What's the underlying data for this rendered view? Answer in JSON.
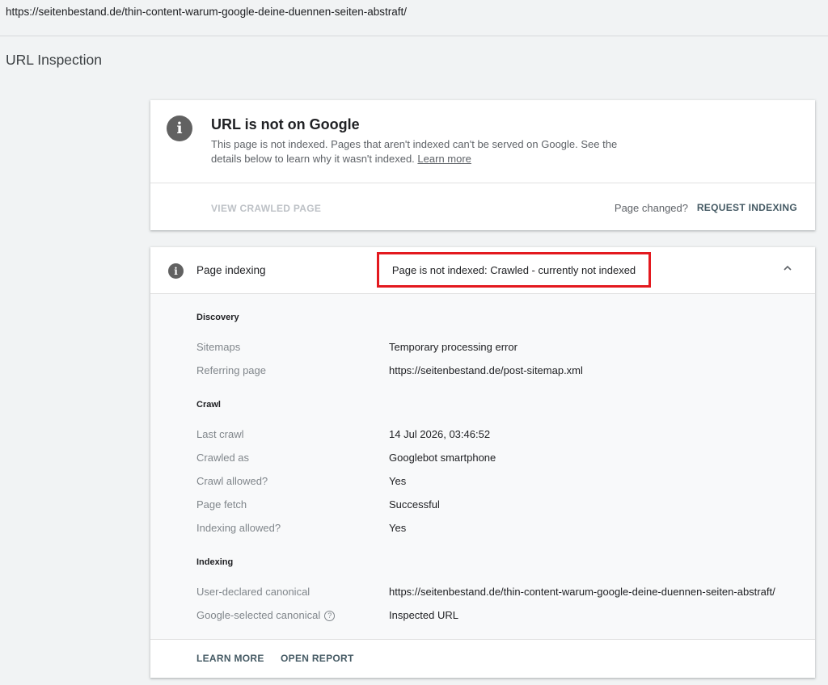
{
  "address_bar": {
    "url": "https://seitenbestand.de/thin-content-warum-google-deine-duennen-seiten-abstraft/"
  },
  "page_title": "URL Inspection",
  "summary_card": {
    "icon": "info-icon",
    "title": "URL is not on Google",
    "description": "This page is not indexed. Pages that aren't indexed can't be served on Google. See the details below to learn why it wasn't indexed.",
    "learn_more_link": "Learn more",
    "view_crawled_page": "VIEW CRAWLED PAGE",
    "page_changed": "Page changed?",
    "request_indexing": "REQUEST INDEXING"
  },
  "indexing_card": {
    "icon": "info-icon",
    "label": "Page indexing",
    "status": "Page is not indexed: Crawled - currently not indexed",
    "highlight_color": "#e3191f",
    "expand_icon": "chevron-up-icon",
    "discovery": {
      "heading": "Discovery",
      "sitemaps_label": "Sitemaps",
      "sitemaps_value": "Temporary processing error",
      "referring_label": "Referring page",
      "referring_value": "https://seitenbestand.de/post-sitemap.xml"
    },
    "crawl": {
      "heading": "Crawl",
      "last_crawl_label": "Last crawl",
      "last_crawl_value": "14 Jul 2026, 03:46:52",
      "crawled_as_label": "Crawled as",
      "crawled_as_value": "Googlebot smartphone",
      "crawl_allowed_label": "Crawl allowed?",
      "crawl_allowed_value": "Yes",
      "page_fetch_label": "Page fetch",
      "page_fetch_value": "Successful",
      "indexing_allowed_label": "Indexing allowed?",
      "indexing_allowed_value": "Yes"
    },
    "indexing": {
      "heading": "Indexing",
      "user_canonical_label": "User-declared canonical",
      "user_canonical_value": "https://seitenbestand.de/thin-content-warum-google-deine-duennen-seiten-abstraft/",
      "google_canonical_label": "Google-selected canonical",
      "google_canonical_help": "?",
      "google_canonical_value": "Inspected URL"
    },
    "learn_more": "LEARN MORE",
    "open_report": "OPEN REPORT"
  }
}
